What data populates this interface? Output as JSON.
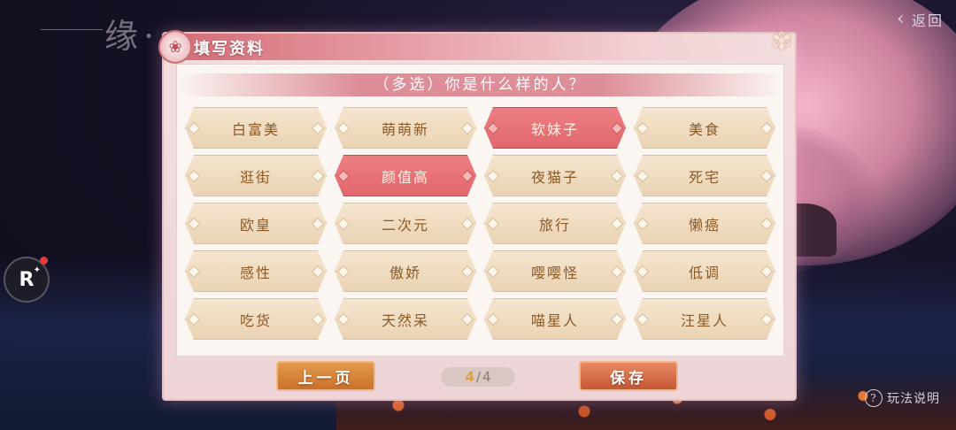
{
  "background": {
    "calligraphy": "缘·",
    "back_label": "返回",
    "help_label": "玩法说明",
    "badge_letter": "R"
  },
  "dialog": {
    "title": "填写资料",
    "question": "（多选）你是什么样的人？",
    "options": [
      {
        "label": "白富美",
        "selected": false
      },
      {
        "label": "萌萌新",
        "selected": false
      },
      {
        "label": "软妹子",
        "selected": true
      },
      {
        "label": "美食",
        "selected": false
      },
      {
        "label": "逛街",
        "selected": false
      },
      {
        "label": "颜值高",
        "selected": true
      },
      {
        "label": "夜猫子",
        "selected": false
      },
      {
        "label": "死宅",
        "selected": false
      },
      {
        "label": "欧皇",
        "selected": false
      },
      {
        "label": "二次元",
        "selected": false
      },
      {
        "label": "旅行",
        "selected": false
      },
      {
        "label": "懒癌",
        "selected": false
      },
      {
        "label": "感性",
        "selected": false
      },
      {
        "label": "傲娇",
        "selected": false
      },
      {
        "label": "嘤嘤怪",
        "selected": false
      },
      {
        "label": "低调",
        "selected": false
      },
      {
        "label": "吃货",
        "selected": false
      },
      {
        "label": "天然呆",
        "selected": false
      },
      {
        "label": "喵星人",
        "selected": false
      },
      {
        "label": "汪星人",
        "selected": false
      }
    ],
    "prev_label": "上一页",
    "save_label": "保存",
    "page_current": "4",
    "page_total": "4"
  },
  "colors": {
    "selected_option": "#e2676e",
    "option": "#ead3b4",
    "option_text": "#8c5a26"
  }
}
